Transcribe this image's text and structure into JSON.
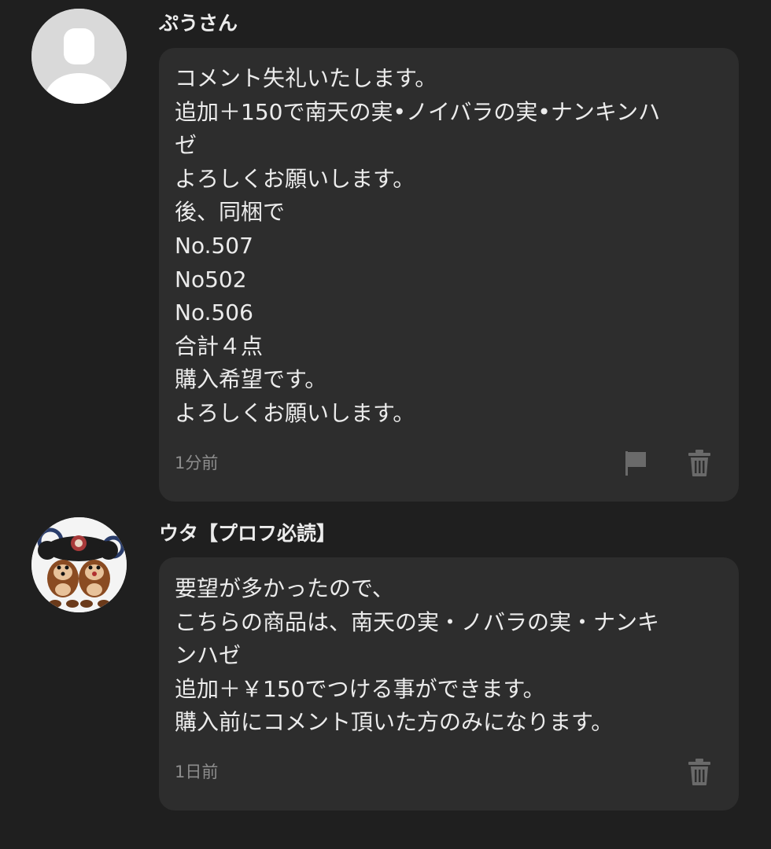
{
  "comments": [
    {
      "username": "ぷうさん",
      "lines": [
        "コメント失礼いたします。",
        "追加＋150で南天の実•ノイバラの実•ナンキンハ",
        "ゼ",
        "よろしくお願いします。",
        "後、同梱で",
        "No.507",
        "No502",
        "No.506",
        "合計４点",
        "購入希望です。",
        "よろしくお願いします。"
      ],
      "timestamp": "1分前",
      "actions": {
        "report_icon": "flag-icon",
        "delete_icon": "trash-icon"
      }
    },
    {
      "username": "ウタ【プロフ必読】",
      "lines": [
        "要望が多かったので、",
        "こちらの商品は、南天の実・ノバラの実・ナンキ",
        "ンハゼ",
        "追加＋￥150でつける事ができます。",
        "購入前にコメント頂いた方のみになります。"
      ],
      "timestamp": "1日前",
      "actions": {
        "delete_icon": "trash-icon"
      }
    }
  ],
  "colors": {
    "background": "#1f1f1f",
    "bubble": "#2d2d2d",
    "text": "#ececec",
    "muted": "#8d8d8d",
    "icon": "#6a6a6a"
  }
}
